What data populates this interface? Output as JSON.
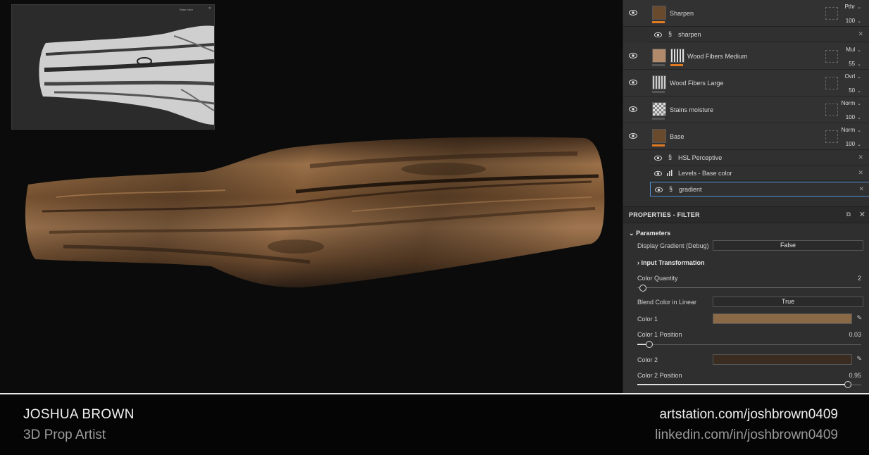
{
  "viewport": {
    "uv_preview_tag": "Base color"
  },
  "layers": [
    {
      "name": "Sharpen",
      "blend": "Pthr",
      "opacity": "100",
      "thumb": "wood-thumb"
    },
    {
      "name": "Wood Fibers Medium",
      "blend": "Mul",
      "opacity": "55",
      "thumb": "wood-fibers-medium-thumb"
    },
    {
      "name": "Wood Fibers Large",
      "blend": "Ovrl",
      "opacity": "50",
      "thumb": "wood-fibers-large-thumb"
    },
    {
      "name": "Stains moisture",
      "blend": "Norm",
      "opacity": "100",
      "thumb": "checker-thumb"
    },
    {
      "name": "Base",
      "blend": "Norm",
      "opacity": "100",
      "thumb": "wood-thumb"
    }
  ],
  "effects": {
    "sharpen": "sharpen",
    "hsl": "HSL Perceptive",
    "levels": "Levels - Base color",
    "gradient": "gradient"
  },
  "properties": {
    "header": "PROPERTIES - FILTER",
    "section": "Parameters",
    "display_gradient_label": "Display Gradient (Debug)",
    "display_gradient_value": "False",
    "input_transformation": "Input Transformation",
    "color_quantity_label": "Color Quantity",
    "color_quantity_value": "2",
    "color_quantity_level": 0.0,
    "blend_linear_label": "Blend Color in Linear",
    "blend_linear_value": "True",
    "color1_label": "Color 1",
    "color1_hex": "#8a6a46",
    "color1_pos_label": "Color 1 Position",
    "color1_pos_value": "0.03",
    "color2_label": "Color 2",
    "color2_hex": "#3a2c20",
    "color2_pos_label": "Color 2 Position",
    "color2_pos_value": "0.95"
  },
  "footer": {
    "name": "JOSHUA BROWN",
    "role": "3D Prop Artist",
    "link1": "artstation.com/joshbrown0409",
    "link2": "linkedin.com/in/joshbrown0409"
  },
  "colors": {
    "accent": "#e07a22",
    "selection": "#4f8fd0",
    "panel_bg": "#2f2f2f"
  }
}
